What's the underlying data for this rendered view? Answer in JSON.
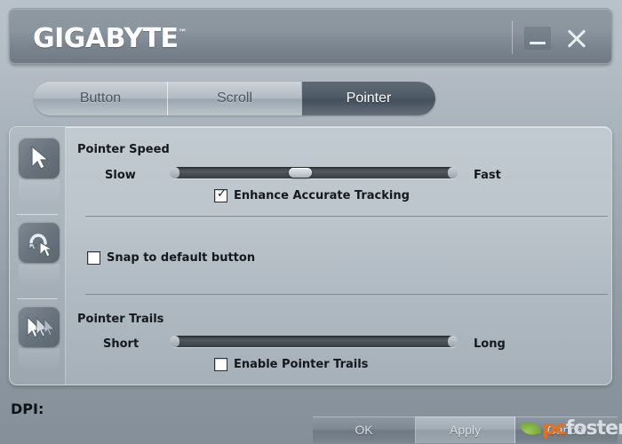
{
  "window": {
    "brand": "GIGABYTE",
    "trademark": "™",
    "minimize_label": "minimize",
    "close_label": "close"
  },
  "tabs": [
    {
      "label": "Button",
      "active": false
    },
    {
      "label": "Scroll",
      "active": false
    },
    {
      "label": "Pointer",
      "active": true
    }
  ],
  "sidebar": {
    "items": [
      {
        "icon": "pointer-speed-cursor-icon",
        "selected": true
      },
      {
        "icon": "snap-to-default-cursor-icon",
        "selected": false
      },
      {
        "icon": "pointer-trails-cursor-icon",
        "selected": false
      }
    ]
  },
  "pointer_speed": {
    "title": "Pointer Speed",
    "min_label": "Slow",
    "max_label": "Fast",
    "slider_value_percent": 45,
    "checkbox": {
      "label": "Enhance Accurate Tracking",
      "checked": true,
      "check_glyph": "✓"
    }
  },
  "snap": {
    "checkbox": {
      "label": "Snap to default button",
      "checked": false,
      "check_glyph": ""
    }
  },
  "pointer_trails": {
    "title": "Pointer Trails",
    "min_label": "Short",
    "max_label": "Long",
    "slider_value_percent": 0,
    "enabled": false,
    "checkbox": {
      "label": "Enable Pointer Trails",
      "checked": false,
      "check_glyph": ""
    }
  },
  "footer": {
    "dpi_label": "DPI:",
    "buttons": [
      {
        "label": "OK"
      },
      {
        "label": "Apply"
      },
      {
        "label": "Cancel"
      }
    ]
  },
  "watermark": {
    "text_primary": "pc",
    "text_secondary": "foster",
    "colors": {
      "primary": "#e8701a",
      "secondary": "#d9dde1",
      "leaf": "#74a83a"
    }
  },
  "colors": {
    "titlebar": "#8a959f",
    "panel": "#b9c2ca",
    "active_tab": "#4e5a65",
    "text": "#15181c"
  }
}
